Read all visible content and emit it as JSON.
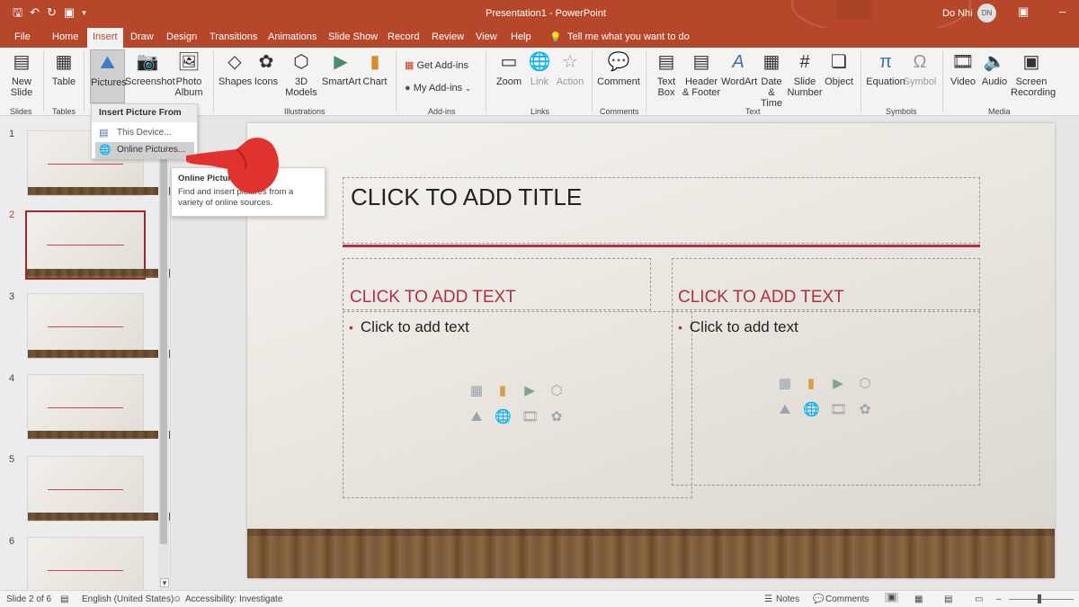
{
  "titlebar": {
    "app_title": "Presentation1  -  PowerPoint",
    "user_name": "Do Nhi",
    "user_initials": "DN",
    "qat_icons": [
      "save-icon",
      "undo-icon",
      "redo-icon",
      "present-icon",
      "customize-icon"
    ]
  },
  "tabs": [
    "File",
    "Home",
    "Insert",
    "Draw",
    "Design",
    "Transitions",
    "Animations",
    "Slide Show",
    "Record",
    "Review",
    "View",
    "Help"
  ],
  "active_tab": "Insert",
  "tell_me": "Tell me what you want to do",
  "ribbon": {
    "new_slide": "New Slide",
    "table": "Table",
    "pictures": "Pictures",
    "screenshot": "Screenshot",
    "photo_album": "Photo Album",
    "shapes": "Shapes",
    "icons": "Icons",
    "models_3d": "3D Models",
    "smartart": "SmartArt",
    "chart": "Chart",
    "get_addins": "Get Add-ins",
    "my_addins": "My Add-ins",
    "zoom": "Zoom",
    "link": "Link",
    "action": "Action",
    "comment": "Comment",
    "text_box": "Text Box",
    "header_footer": "Header & Footer",
    "wordart": "WordArt",
    "date_time": "Date & Time",
    "slide_number": "Slide Number",
    "object": "Object",
    "equation": "Equation",
    "symbol": "Symbol",
    "video": "Video",
    "audio": "Audio",
    "screen_recording": "Screen Recording",
    "groups": {
      "slides": "Slides",
      "tables": "Tables",
      "illustrations": "Illustrations",
      "addins": "Add-ins",
      "links": "Links",
      "comments": "Comments",
      "text": "Text",
      "symbols": "Symbols",
      "media": "Media"
    }
  },
  "dropdown": {
    "header": "Insert Picture From",
    "items": [
      "This Device...",
      "Online Pictures..."
    ]
  },
  "tooltip": {
    "title": "Online Pictures",
    "body": "Find and insert pictures from a variety of online sources."
  },
  "thumbnails": [
    "1",
    "2",
    "3",
    "4",
    "5",
    "6"
  ],
  "selected_slide": 2,
  "slide": {
    "title": "CLICK TO ADD TITLE",
    "left_header": "CLICK TO ADD TEXT",
    "left_bullet": "Click to add text",
    "right_header": "CLICK TO ADD TEXT",
    "right_bullet": "Click to add text"
  },
  "status": {
    "slide_info": "Slide 2 of 6",
    "language": "English (United States)",
    "accessibility": "Accessibility: Investigate",
    "notes": "Notes",
    "comments": "Comments"
  },
  "colors": {
    "accent": "#b7472a",
    "slide_accent": "#b03046"
  }
}
